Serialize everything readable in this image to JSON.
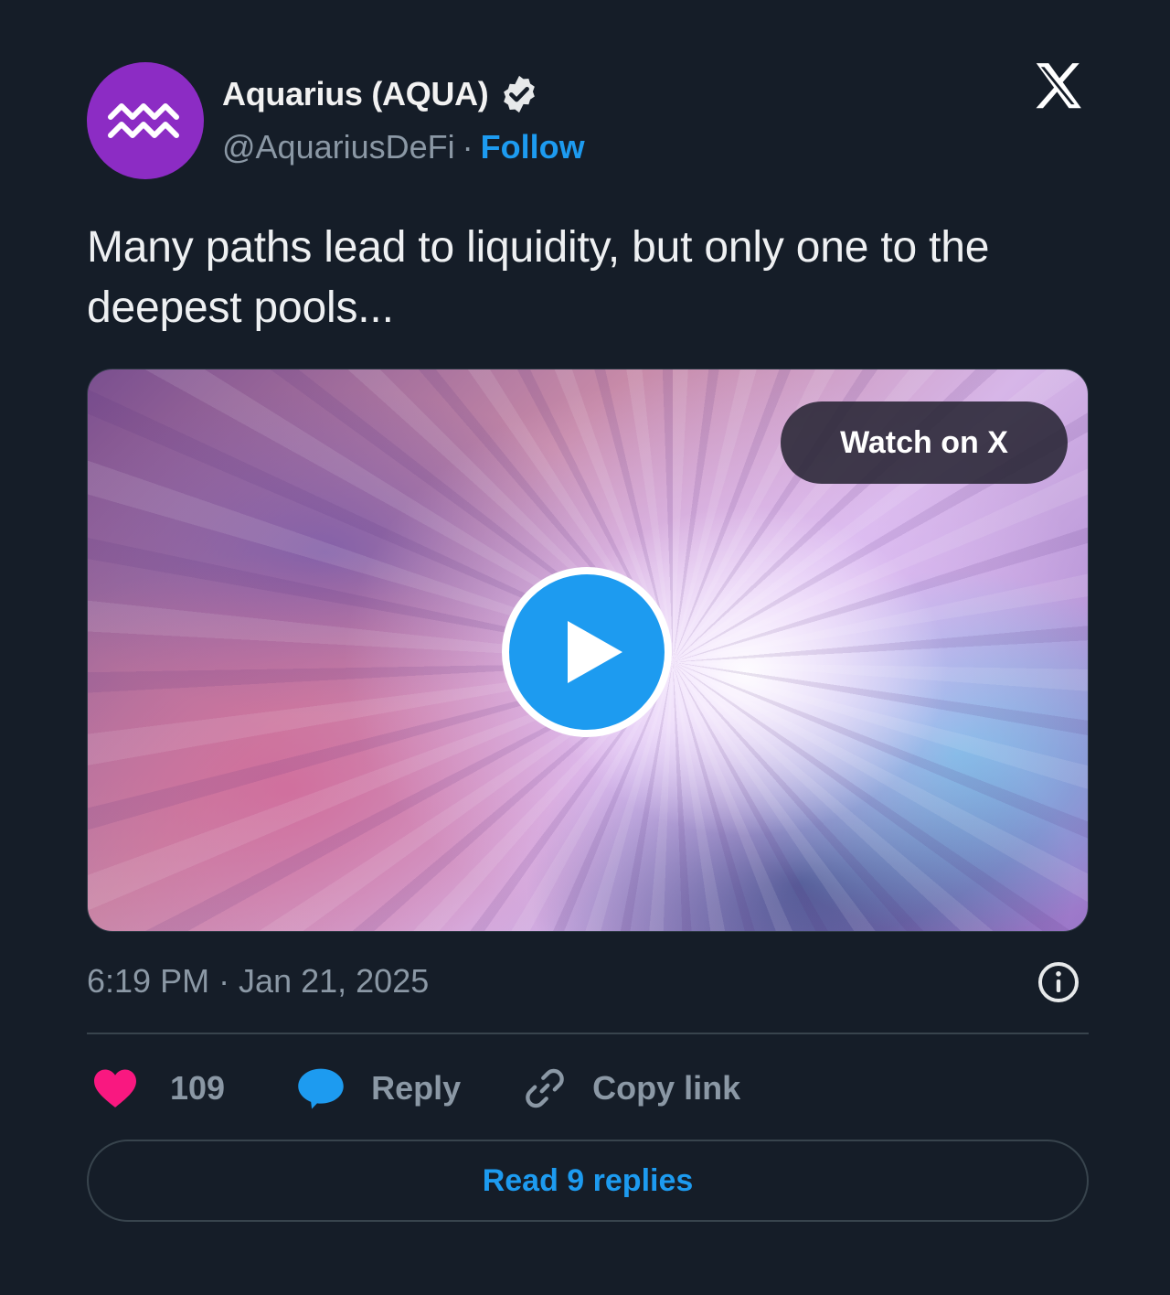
{
  "author": {
    "display_name": "Aquarius (AQUA)",
    "handle": "@AquariusDeFi",
    "separator": "·",
    "follow_label": "Follow",
    "avatar_icon": "aquarius-zodiac-icon",
    "avatar_color": "#8c2cc4",
    "verified": true
  },
  "tweet": {
    "text": "Many paths lead to liquidity, but only one to the deepest pools..."
  },
  "media": {
    "type": "video",
    "watch_label": "Watch on X",
    "play_icon": "play-icon"
  },
  "meta": {
    "timestamp": "6:19 PM · Jan 21, 2025",
    "info_icon": "info-icon"
  },
  "actions": {
    "like_count": "109",
    "reply_label": "Reply",
    "copy_link_label": "Copy link"
  },
  "read_replies_label": "Read 9 replies",
  "colors": {
    "background": "#151d28",
    "accent": "#1d9bf0",
    "like": "#f91880",
    "muted": "#8b98a5"
  }
}
